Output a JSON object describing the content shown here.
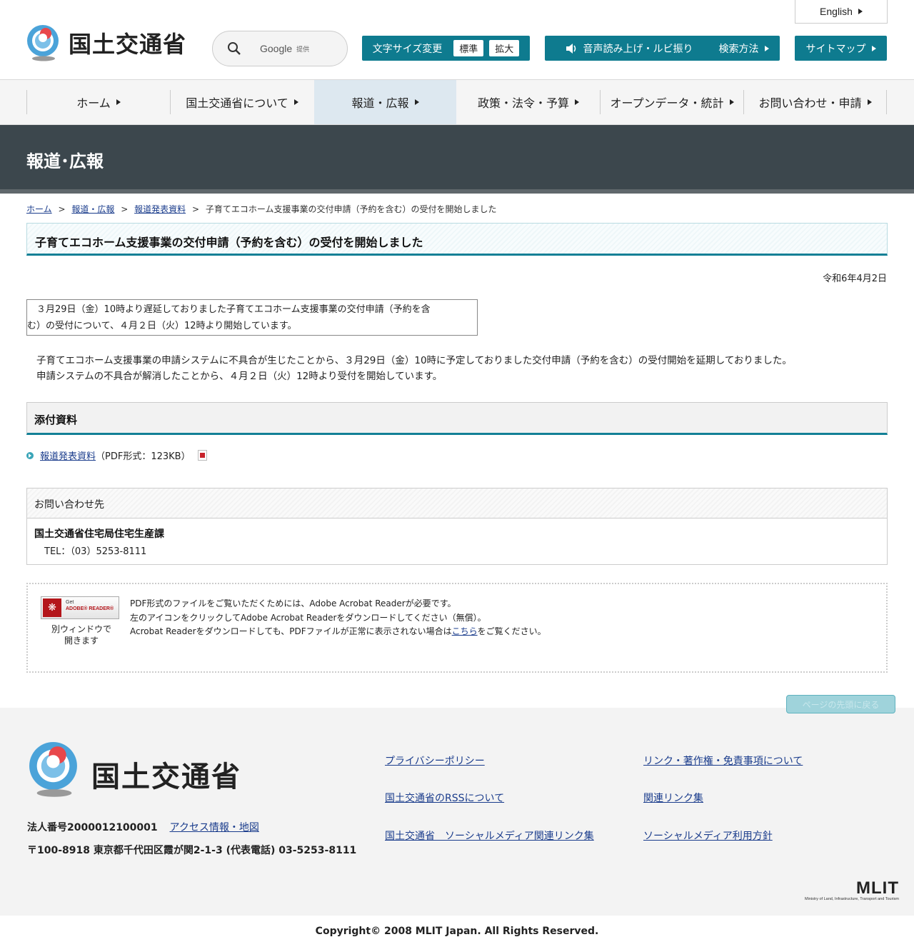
{
  "header": {
    "logo_text": "国土交通省",
    "search_brand": "Google",
    "search_sub": "提供",
    "english_label": "English",
    "font_size_label": "文字サイズ変更",
    "font_std": "標準",
    "font_large": "拡大",
    "voice_label": "音声読み上げ・ルビ振り",
    "search_method_label": "検索方法",
    "sitemap_label": "サイトマップ"
  },
  "nav": {
    "items": [
      {
        "label": "ホーム"
      },
      {
        "label": "国土交通省について"
      },
      {
        "label": "報道・広報"
      },
      {
        "label": "政策・法令・予算"
      },
      {
        "label": "オープンデータ・統計"
      },
      {
        "label": "お問い合わせ・申請"
      }
    ]
  },
  "banner": {
    "title": "報道･広報"
  },
  "breadcrumb": {
    "items": [
      "ホーム",
      "報道・広報",
      "報道発表資料"
    ],
    "current": "子育てエコホーム支援事業の交付申請（予約を含む）の受付を開始しました",
    "separator": ">"
  },
  "article": {
    "title": "子育てエコホーム支援事業の交付申請（予約を含む）の受付を開始しました",
    "date": "令和6年4月2日",
    "notice_line1": "　３月29日（金）10時より遅延しておりました子育てエコホーム支援事業の交付申請（予約を含",
    "notice_line2": "む）の受付について、４月２日（火）12時より開始しています。",
    "body_line1": "子育てエコホーム支援事業の申請システムに不具合が生じたことから、３月29日（金）10時に予定しておりました交付申請（予約を含む）の受付開始を延期しておりました。",
    "body_line2": "申請システムの不具合が解消したことから、４月２日（火）12時より受付を開始しています。"
  },
  "attachments": {
    "heading": "添付資料",
    "link_label": "報道発表資料",
    "link_info": "（PDF形式：123KB）"
  },
  "contact": {
    "heading": "お問い合わせ先",
    "org": "国土交通省住宅局住宅生産課",
    "tel": "TEL：（03）5253-8111"
  },
  "adobe": {
    "badge_get": "Get",
    "badge_reader": "ADOBE® READER®",
    "caption_line1": "別ウィンドウで",
    "caption_line2": "開きます",
    "text_line1": "PDF形式のファイルをご覧いただくためには、Adobe Acrobat Readerが必要です。",
    "text_line2": "左のアイコンをクリックしてAdobe Acrobat Readerをダウンロードしてください（無償）。",
    "text_line3_pre": "Acrobat Readerをダウンロードしても、PDFファイルが正常に表示されない場合は",
    "text_line3_link": "こちら",
    "text_line3_post": "をご覧ください。"
  },
  "page_top_label": "ページの先頭に戻る",
  "footer": {
    "logo_text": "国土交通省",
    "corp_number": "法人番号2000012100001",
    "access_link": "アクセス情報・地図",
    "address": "〒100-8918 東京都千代田区霞が関2-1-3 (代表電話) 03-5253-8111",
    "links_left": [
      "プライバシーポリシー",
      "国土交通省のRSSについて",
      "国土交通省　ソーシャルメディア関連リンク集"
    ],
    "links_right": [
      "リンク・著作権・免責事項について",
      "関連リンク集",
      "ソーシャルメディア利用方針"
    ],
    "mlit_logo": "MLIT",
    "mlit_sub": "Ministry of Land, Infrastructure, Transport and Tourism",
    "copyright": "Copyright© 2008 MLIT Japan. All Rights Reserved."
  },
  "colors": {
    "accent_teal": "#0e7b8f",
    "banner_bg": "#3c474d",
    "link_blue": "#1a3c8c",
    "logo_blue": "#4ba3d9",
    "logo_red": "#e8474b"
  }
}
